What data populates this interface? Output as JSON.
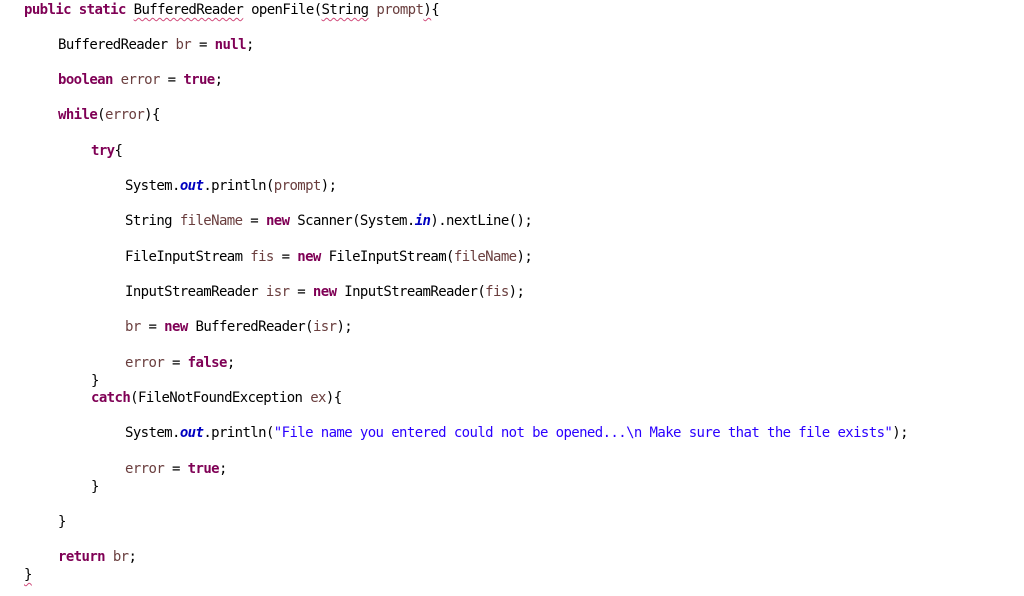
{
  "editor": {
    "language": "java",
    "colors": {
      "keyword": "#7F0055",
      "local_variable": "#6A3E3E",
      "static_field": "#0000C0",
      "string": "#2A00FF",
      "default": "#000000",
      "error_squiggle": "#d04a7a"
    },
    "lines": [
      {
        "tokens": [
          {
            "t": "public static",
            "c": "kw"
          },
          {
            "t": " ",
            "c": "plain"
          },
          {
            "t": "BufferedReader",
            "c": "plain",
            "squiggle": true
          },
          {
            "t": " openFile(",
            "c": "plain"
          },
          {
            "t": "String",
            "c": "plain",
            "squiggle": true
          },
          {
            "t": " ",
            "c": "plain"
          },
          {
            "t": "prompt",
            "c": "var"
          },
          {
            "t": ")",
            "c": "plain",
            "squiggle": true
          },
          {
            "t": "{",
            "c": "plain"
          }
        ]
      },
      {
        "tokens": [
          {
            "t": "BufferedReader ",
            "c": "plain"
          },
          {
            "t": "br",
            "c": "var"
          },
          {
            "t": " = ",
            "c": "plain"
          },
          {
            "t": "null",
            "c": "kw"
          },
          {
            "t": ";",
            "c": "plain"
          }
        ]
      },
      {
        "tokens": [
          {
            "t": "boolean",
            "c": "kw"
          },
          {
            "t": " ",
            "c": "plain"
          },
          {
            "t": "error",
            "c": "var"
          },
          {
            "t": " = ",
            "c": "plain"
          },
          {
            "t": "true",
            "c": "kw"
          },
          {
            "t": ";",
            "c": "plain"
          }
        ]
      },
      {
        "tokens": [
          {
            "t": "while",
            "c": "kw"
          },
          {
            "t": "(",
            "c": "plain"
          },
          {
            "t": "error",
            "c": "var"
          },
          {
            "t": "){",
            "c": "plain"
          }
        ]
      },
      {
        "tokens": [
          {
            "t": "try",
            "c": "kw"
          },
          {
            "t": "{",
            "c": "plain"
          }
        ]
      },
      {
        "tokens": [
          {
            "t": "System.",
            "c": "plain"
          },
          {
            "t": "out",
            "c": "field"
          },
          {
            "t": ".println(",
            "c": "plain"
          },
          {
            "t": "prompt",
            "c": "var"
          },
          {
            "t": ");",
            "c": "plain"
          }
        ]
      },
      {
        "tokens": [
          {
            "t": "String ",
            "c": "plain"
          },
          {
            "t": "fileName",
            "c": "var"
          },
          {
            "t": " = ",
            "c": "plain"
          },
          {
            "t": "new",
            "c": "kw"
          },
          {
            "t": " Scanner(System.",
            "c": "plain"
          },
          {
            "t": "in",
            "c": "field"
          },
          {
            "t": ").nextLine();",
            "c": "plain"
          }
        ]
      },
      {
        "tokens": [
          {
            "t": "FileInputStream ",
            "c": "plain"
          },
          {
            "t": "fis",
            "c": "var"
          },
          {
            "t": " = ",
            "c": "plain"
          },
          {
            "t": "new",
            "c": "kw"
          },
          {
            "t": " FileInputStream(",
            "c": "plain"
          },
          {
            "t": "fileName",
            "c": "var"
          },
          {
            "t": ");",
            "c": "plain"
          }
        ]
      },
      {
        "tokens": [
          {
            "t": "InputStreamReader ",
            "c": "plain"
          },
          {
            "t": "isr",
            "c": "var"
          },
          {
            "t": " = ",
            "c": "plain"
          },
          {
            "t": "new",
            "c": "kw"
          },
          {
            "t": " InputStreamReader(",
            "c": "plain"
          },
          {
            "t": "fis",
            "c": "var"
          },
          {
            "t": ");",
            "c": "plain"
          }
        ]
      },
      {
        "tokens": [
          {
            "t": "br",
            "c": "var"
          },
          {
            "t": " = ",
            "c": "plain"
          },
          {
            "t": "new",
            "c": "kw"
          },
          {
            "t": " BufferedReader(",
            "c": "plain"
          },
          {
            "t": "isr",
            "c": "var"
          },
          {
            "t": ");",
            "c": "plain"
          }
        ]
      },
      {
        "tokens": [
          {
            "t": "error",
            "c": "var"
          },
          {
            "t": " = ",
            "c": "plain"
          },
          {
            "t": "false",
            "c": "kw"
          },
          {
            "t": ";",
            "c": "plain"
          }
        ]
      },
      {
        "tokens": [
          {
            "t": "}",
            "c": "plain"
          }
        ]
      },
      {
        "tokens": [
          {
            "t": "catch",
            "c": "kw"
          },
          {
            "t": "(FileNotFoundException ",
            "c": "plain"
          },
          {
            "t": "ex",
            "c": "var"
          },
          {
            "t": "){",
            "c": "plain"
          }
        ]
      },
      {
        "tokens": [
          {
            "t": "System.",
            "c": "plain"
          },
          {
            "t": "out",
            "c": "field"
          },
          {
            "t": ".println(",
            "c": "plain"
          },
          {
            "t": "\"File name you entered could not be opened...\\n Make sure that the file exists\"",
            "c": "str"
          },
          {
            "t": ");",
            "c": "plain"
          }
        ]
      },
      {
        "tokens": [
          {
            "t": "error",
            "c": "var"
          },
          {
            "t": " = ",
            "c": "plain"
          },
          {
            "t": "true",
            "c": "kw"
          },
          {
            "t": ";",
            "c": "plain"
          }
        ]
      },
      {
        "tokens": [
          {
            "t": "}",
            "c": "plain"
          }
        ]
      },
      {
        "tokens": [
          {
            "t": "}",
            "c": "plain"
          }
        ]
      },
      {
        "tokens": [
          {
            "t": "return",
            "c": "kw"
          },
          {
            "t": " ",
            "c": "plain"
          },
          {
            "t": "br",
            "c": "var"
          },
          {
            "t": ";",
            "c": "plain"
          }
        ]
      },
      {
        "tokens": [
          {
            "t": "}",
            "c": "plain",
            "squiggle": true
          }
        ]
      }
    ]
  }
}
